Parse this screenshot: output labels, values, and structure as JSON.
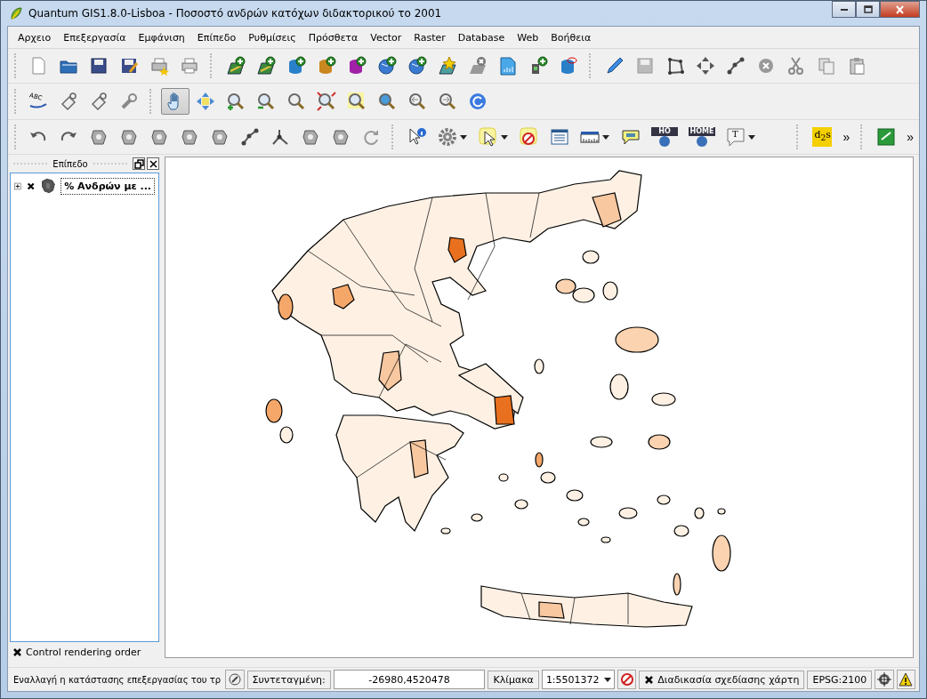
{
  "window": {
    "title": "Quantum GIS1.8.0-Lisboa - Ποσοστό ανδρών κατόχων διδακτορικού το 2001"
  },
  "menu": [
    "Αρχειο",
    "Επεξεργασία",
    "Εμφάνιση",
    "Επίπεδο",
    "Ρυθμίσεις",
    "Πρόσθετα",
    "Vector",
    "Raster",
    "Database",
    "Web",
    "Βοήθεια"
  ],
  "toolbars": [
    {
      "tools": [
        {
          "kind": "page"
        },
        {
          "kind": "folder"
        },
        {
          "kind": "disk"
        },
        {
          "kind": "disk-edit"
        },
        {
          "kind": "printer-star"
        },
        {
          "kind": "printer"
        },
        {
          "kind": "separator"
        },
        {
          "kind": "layer-add"
        },
        {
          "kind": "layer-add"
        },
        {
          "kind": "database-add",
          "color": "#2a7fc9"
        },
        {
          "kind": "database-add",
          "color": "#c9871f"
        },
        {
          "kind": "database-add",
          "color": "#a020a8"
        },
        {
          "kind": "globe-add"
        },
        {
          "kind": "globe-add"
        },
        {
          "kind": "star-map"
        },
        {
          "kind": "layer-delete"
        },
        {
          "kind": "file-chart"
        },
        {
          "kind": "plug-add"
        },
        {
          "kind": "database-link",
          "color": "#2a7fc9"
        },
        {
          "kind": "separator"
        },
        {
          "kind": "pencil"
        },
        {
          "kind": "disk-grey"
        },
        {
          "kind": "polygon"
        },
        {
          "kind": "move"
        },
        {
          "kind": "nodes"
        },
        {
          "kind": "circle-x"
        },
        {
          "kind": "scissors"
        },
        {
          "kind": "copy"
        },
        {
          "kind": "paste"
        }
      ]
    },
    {
      "tools": [
        {
          "kind": "label",
          "label": "ABC"
        },
        {
          "kind": "pin"
        },
        {
          "kind": "pin"
        },
        {
          "kind": "wrench"
        },
        {
          "kind": "separator"
        },
        {
          "kind": "hand",
          "selected": true
        },
        {
          "kind": "pan-to",
          "selected": false
        },
        {
          "kind": "zoom-in",
          "selected": false
        },
        {
          "kind": "zoom-out",
          "selected": false
        },
        {
          "kind": "zoom",
          "selected": false
        },
        {
          "kind": "zoom-full",
          "selected": false
        },
        {
          "kind": "zoom-select",
          "selected": false
        },
        {
          "kind": "zoom-layer",
          "selected": false
        },
        {
          "kind": "zoom-last",
          "selected": false
        },
        {
          "kind": "zoom-next",
          "selected": false
        },
        {
          "kind": "refresh",
          "selected": false
        }
      ]
    },
    {
      "tools": [
        {
          "kind": "undo"
        },
        {
          "kind": "redo"
        },
        {
          "kind": "shape"
        },
        {
          "kind": "shape"
        },
        {
          "kind": "shape"
        },
        {
          "kind": "shape"
        },
        {
          "kind": "shape"
        },
        {
          "kind": "nodes"
        },
        {
          "kind": "split"
        },
        {
          "kind": "shape"
        },
        {
          "kind": "shape"
        },
        {
          "kind": "rotate"
        },
        {
          "kind": "separator"
        },
        {
          "kind": "identify"
        },
        {
          "kind": "gear",
          "dropdown": true
        },
        {
          "kind": "select",
          "dropdown": true
        },
        {
          "kind": "deselect"
        },
        {
          "kind": "table"
        },
        {
          "kind": "ruler",
          "dropdown": true
        },
        {
          "kind": "speech"
        },
        {
          "kind": "home-globe",
          "label": "HO"
        },
        {
          "kind": "home-globe",
          "label": "HOME"
        },
        {
          "kind": "text",
          "label": "T",
          "dropdown": true
        },
        {
          "kind": "spacer"
        },
        {
          "kind": "separator"
        },
        {
          "kind": "plugin-logo",
          "label": "d$_{2}$s"
        },
        {
          "kind": "overflow",
          "label": "»"
        },
        {
          "kind": "separator"
        },
        {
          "kind": "green-plugin"
        },
        {
          "kind": "overflow",
          "label": "»"
        }
      ]
    }
  ],
  "layers_panel": {
    "title": "Επίπεδο",
    "layers": [
      {
        "name": "% Ανδρών με ...",
        "visible": true,
        "expanded": false,
        "selected": true
      }
    ],
    "control_rendering_order": {
      "label": "Control rendering order",
      "checked": true
    }
  },
  "status_bar": {
    "message": "Εναλλαγή η κατάστασης επεξεργασίας του τρ",
    "coordinate_label": "Συντεταγμένη:",
    "coordinate": "-26980,4520478",
    "scale_label": "Κλίμακα",
    "scale": "1:5501372",
    "render": {
      "label": "Διαδικασία σχεδίασης χάρτη",
      "checked": true
    },
    "crs": "EPSG:2100"
  }
}
